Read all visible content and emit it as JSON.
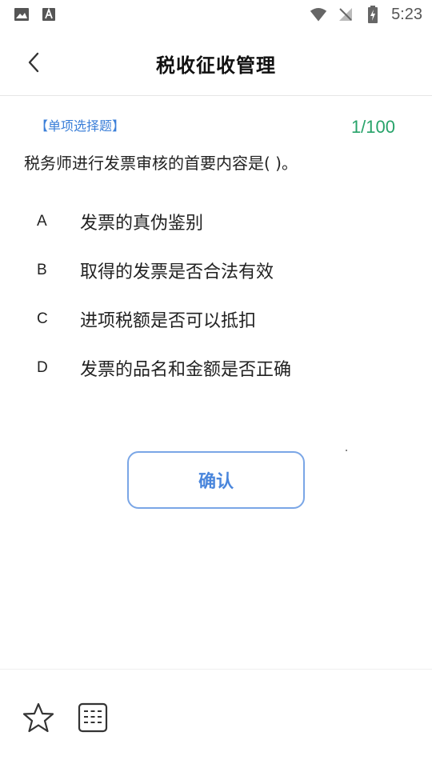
{
  "statusbar": {
    "left_icons": [
      "image-icon",
      "text-a-icon"
    ],
    "right_icons": [
      "wifi-icon",
      "no-signal-icon",
      "battery-charging-icon"
    ],
    "time": "5:23"
  },
  "header": {
    "title": "税收征收管理",
    "back_icon": "chevron-left-icon"
  },
  "question": {
    "type_label": "【单项选择题】",
    "progress": "1/100",
    "text": "税务师进行发票审核的首要内容是(    )。",
    "options": [
      {
        "letter": "A",
        "text": "发票的真伪鉴别"
      },
      {
        "letter": "B",
        "text": "取得的发票是否合法有效"
      },
      {
        "letter": "C",
        "text": "进项税额是否可以抵扣"
      },
      {
        "letter": "D",
        "text": "发票的品名和金额是否正确"
      }
    ]
  },
  "confirm_label": "确认",
  "bottombar": {
    "icons": [
      "star-icon",
      "answer-sheet-grid-icon"
    ]
  },
  "colors": {
    "accent_blue": "#4a86dc",
    "progress_green": "#27a36a",
    "type_blue": "#3b7fd8"
  }
}
